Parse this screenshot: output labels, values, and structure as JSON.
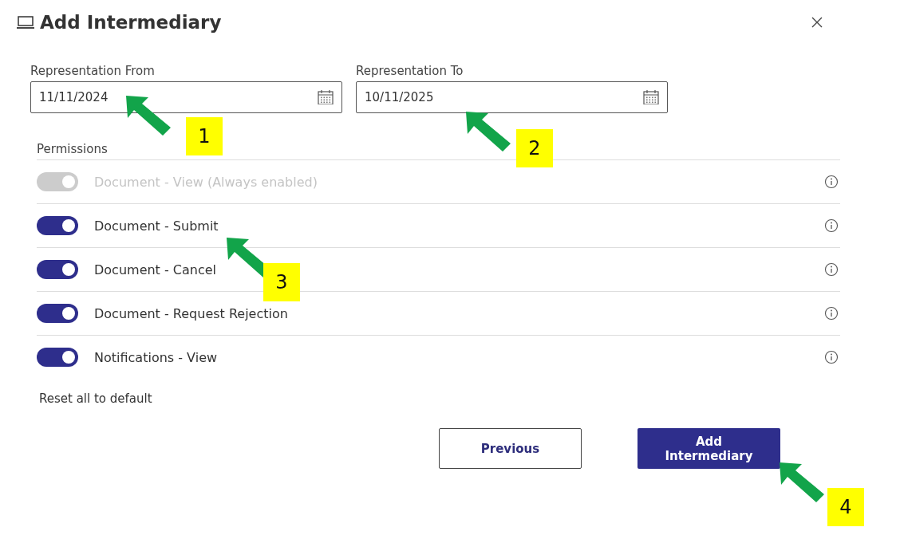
{
  "dialog": {
    "title": "Add Intermediary",
    "fields": [
      {
        "label": "Representation From",
        "value": "11/11/2024"
      },
      {
        "label": "Representation To",
        "value": "10/11/2025"
      }
    ],
    "permissions": {
      "heading": "Permissions",
      "items": [
        {
          "label": "Document - View (Always enabled)",
          "on": true,
          "disabled": true
        },
        {
          "label": "Document - Submit",
          "on": true,
          "disabled": false
        },
        {
          "label": "Document - Cancel",
          "on": true,
          "disabled": false
        },
        {
          "label": "Document - Request Rejection",
          "on": true,
          "disabled": false
        },
        {
          "label": "Notifications - View",
          "on": true,
          "disabled": false
        }
      ]
    },
    "reset_link": "Reset all to default",
    "buttons": [
      {
        "label": "Previous",
        "kind": "secondary"
      },
      {
        "label": "Add Intermediary",
        "kind": "primary"
      }
    ]
  },
  "annotations": [
    {
      "label": "1"
    },
    {
      "label": "2"
    },
    {
      "label": "3"
    },
    {
      "label": "4"
    }
  ]
}
